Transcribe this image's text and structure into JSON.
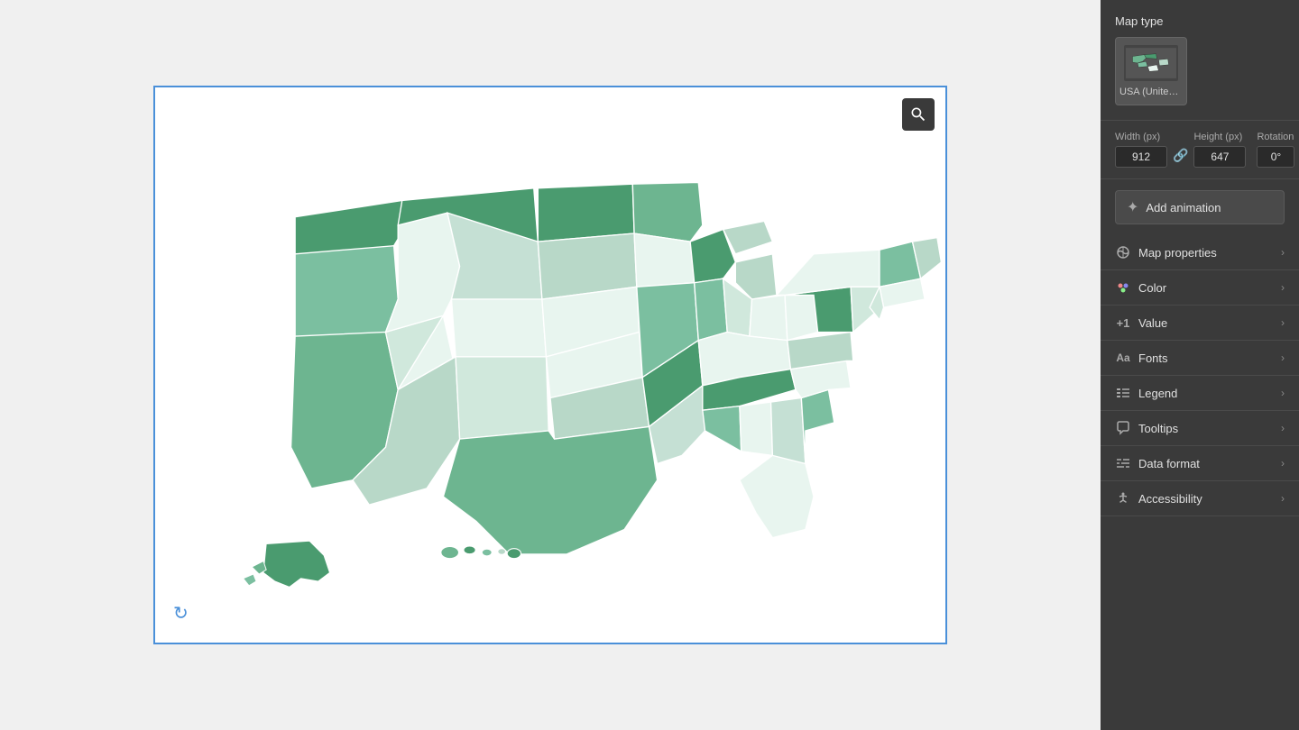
{
  "panel": {
    "map_type_label": "Map type",
    "map_type_card_label": "USA (United States ...",
    "dimensions": {
      "width_label": "Width (px)",
      "height_label": "Height (px)",
      "rotation_label": "Rotation",
      "width_value": "912",
      "height_value": "647",
      "rotation_value": "0°"
    },
    "add_animation_label": "Add animation",
    "properties": [
      {
        "icon": "🗺",
        "label": "Map properties"
      },
      {
        "icon": "🎨",
        "label": "Color"
      },
      {
        "icon": "+1",
        "label": "Value"
      },
      {
        "icon": "Aa",
        "label": "Fonts"
      },
      {
        "icon": "≡",
        "label": "Legend"
      },
      {
        "icon": "💬",
        "label": "Tooltips"
      },
      {
        "icon": "≣",
        "label": "Data format"
      },
      {
        "icon": "♿",
        "label": "Accessibility"
      }
    ]
  },
  "icons": {
    "zoom": "zoom",
    "link": "🔗",
    "animation": "✦",
    "chevron_right": "›",
    "loading": "↻"
  }
}
